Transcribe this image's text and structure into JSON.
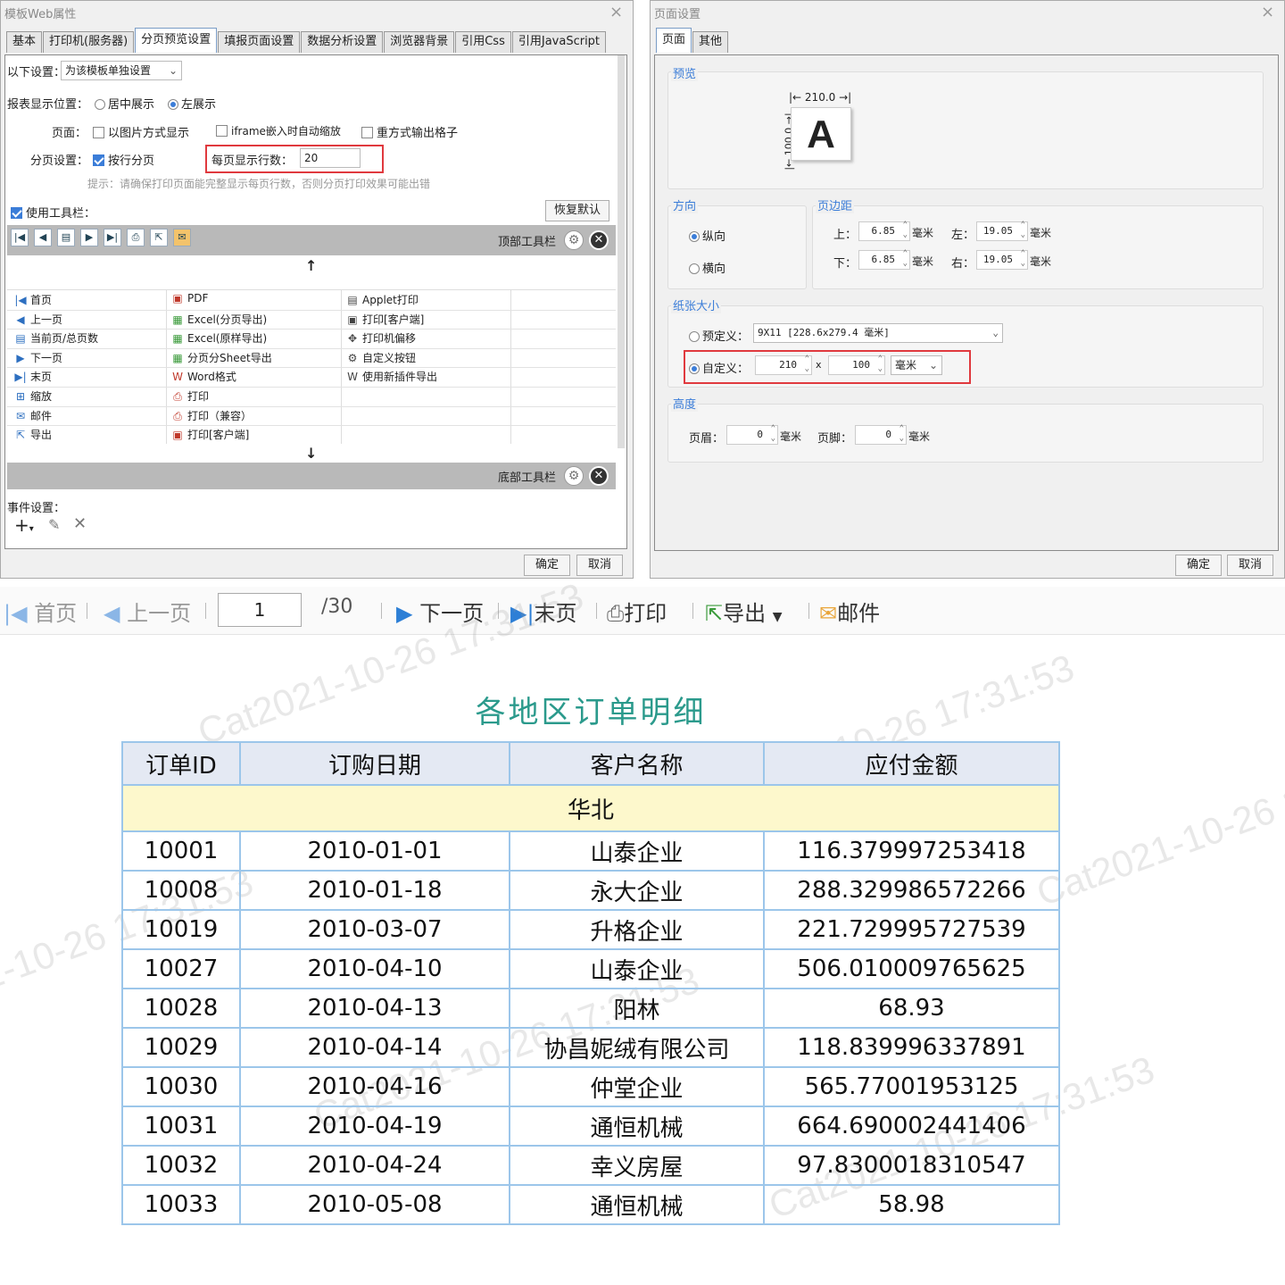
{
  "left_dialog": {
    "title": "模板Web属性",
    "tabs": [
      "基本",
      "打印机(服务器)",
      "分页预览设置",
      "填报页面设置",
      "数据分析设置",
      "浏览器背景",
      "引用Css",
      "引用JavaScript"
    ],
    "active_tab": "分页预览设置",
    "settings_label": "以下设置：",
    "settings_value": "为该模板单独设置",
    "report_pos_label": "报表显示位置：",
    "report_pos_options": [
      "居中展示",
      "左展示"
    ],
    "report_pos_selected": "左展示",
    "page_label": "页面：",
    "page_opt1": "以图片方式显示",
    "page_opt2": "iframe嵌入时自动缩放",
    "page_opt3": "重方式输出格子",
    "paging_label": "分页设置：",
    "paging_opt": "按行分页",
    "rows_label": "每页显示行数：",
    "rows_value": "20",
    "hint": "提示：请确保打印页面能完整显示每页行数，否则分页打印效果可能出错",
    "use_toolbar": "使用工具栏：",
    "restore_default": "恢复默认",
    "top_toolbar": "顶部工具栏",
    "bottom_toolbar": "底部工具栏",
    "col1": [
      "首页",
      "上一页",
      "当前页/总页数",
      "下一页",
      "末页",
      "缩放",
      "邮件",
      "导出"
    ],
    "col2": [
      "PDF",
      "Excel(分页导出)",
      "Excel(原样导出)",
      "分页分Sheet导出",
      "Word格式",
      "打印",
      "打印（兼容）",
      "打印[客户端]"
    ],
    "col3": [
      "Applet打印",
      "打印[客户端]",
      "打印机偏移",
      "自定义按钮",
      "使用新插件导出"
    ],
    "event_label": "事件设置：",
    "ok": "确定",
    "cancel": "取消"
  },
  "right_dialog": {
    "title": "页面设置",
    "tabs": [
      "页面",
      "其他"
    ],
    "preview_label": "预览",
    "preview_width": "210.0",
    "preview_height": "100.0",
    "preview_letter": "A",
    "orientation_label": "方向",
    "portrait": "纵向",
    "landscape": "横向",
    "margin_label": "页边距",
    "top": "上：",
    "bottom": "下：",
    "left": "左：",
    "right": "右：",
    "margin_top": "6.85",
    "margin_bottom": "6.85",
    "margin_left": "19.05",
    "margin_right": "19.05",
    "unit": "毫米",
    "paper_label": "纸张大小",
    "predefined": "预定义：",
    "predefined_value": "9X11 [228.6x279.4 毫米]",
    "custom": "自定义：",
    "custom_w": "210",
    "custom_x": "x",
    "custom_h": "100",
    "custom_unit": "毫米",
    "height_label": "高度",
    "header": "页眉：",
    "footer": "页脚：",
    "header_val": "0",
    "footer_val": "0",
    "ok": "确定",
    "cancel": "取消"
  },
  "report_toolbar": {
    "first": "首页",
    "prev": "上一页",
    "page": "1",
    "total": "/30",
    "next": "下一页",
    "last": "末页",
    "print": "打印",
    "export": "导出",
    "email": "邮件"
  },
  "report": {
    "title": "各地区订单明细",
    "headers": [
      "订单ID",
      "订购日期",
      "客户名称",
      "应付金额"
    ],
    "region": "华北",
    "rows": [
      [
        "10001",
        "2010-01-01",
        "山泰企业",
        "116.379997253418"
      ],
      [
        "10008",
        "2010-01-18",
        "永大企业",
        "288.329986572266"
      ],
      [
        "10019",
        "2010-03-07",
        "升格企业",
        "221.729995727539"
      ],
      [
        "10027",
        "2010-04-10",
        "山泰企业",
        "506.010009765625"
      ],
      [
        "10028",
        "2010-04-13",
        "阳林",
        "68.93"
      ],
      [
        "10029",
        "2010-04-14",
        "协昌妮绒有限公司",
        "118.839996337891"
      ],
      [
        "10030",
        "2010-04-16",
        "仲堂企业",
        "565.77001953125"
      ],
      [
        "10031",
        "2010-04-19",
        "通恒机械",
        "664.690002441406"
      ],
      [
        "10032",
        "2010-04-24",
        "幸义房屋",
        "97.8300018310547"
      ],
      [
        "10033",
        "2010-05-08",
        "通恒机械",
        "58.98"
      ]
    ],
    "watermark": "Cat2021-10-26 17:31:53",
    "title_color": "#2b9a8c"
  }
}
